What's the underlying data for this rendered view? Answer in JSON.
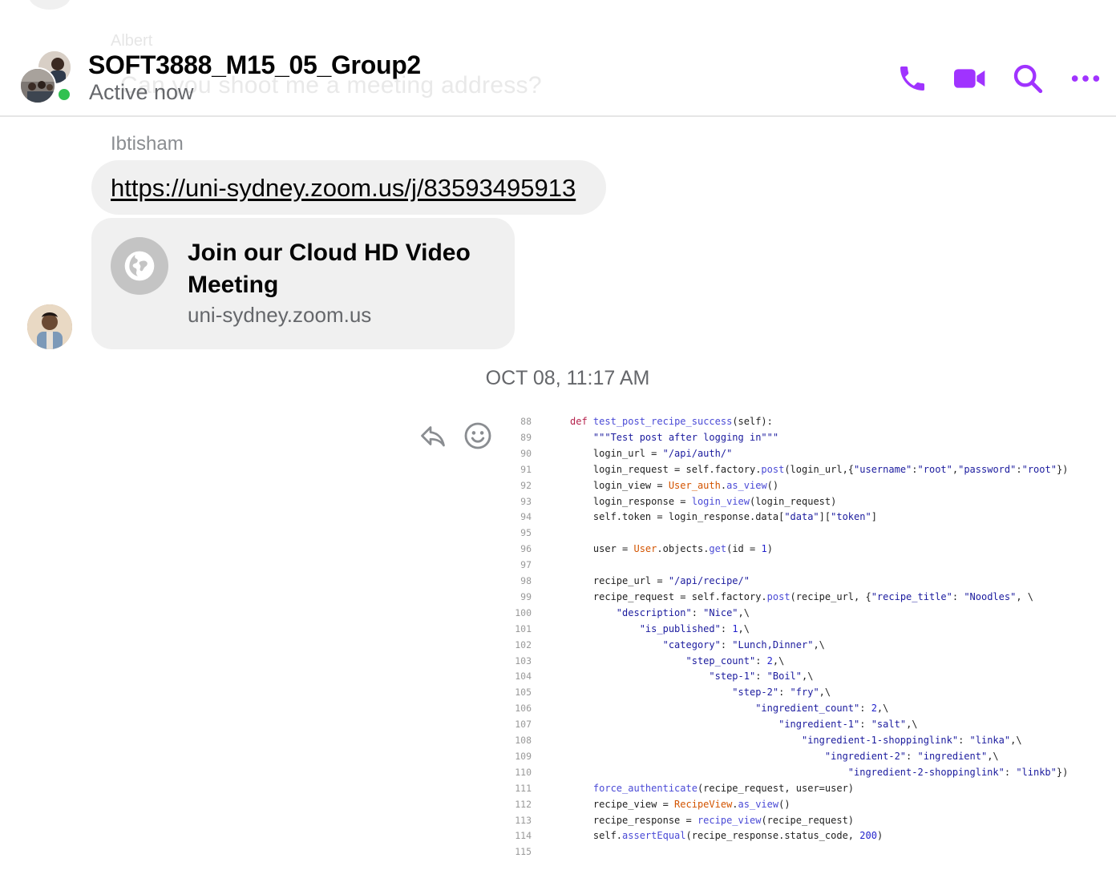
{
  "header": {
    "title": "SOFT3888_M15_05_Group2",
    "status": "Active now",
    "accent_color": "#a033ff",
    "actions": [
      "phone-icon",
      "video-camera-icon",
      "search-icon",
      "more-icon"
    ]
  },
  "ghost": {
    "name": "Albert",
    "message": "Can you shoot me a meeting address?"
  },
  "message": {
    "sender": "Ibtisham",
    "link_text": "https://uni-sydney.zoom.us/j/83593495913",
    "preview_title": "Join our Cloud HD Video Meeting",
    "preview_domain": "uni-sydney.zoom.us"
  },
  "timestamp": "OCT 08, 11:17 AM",
  "message_actions": [
    "reply-icon",
    "emoji-icon"
  ],
  "code_image": {
    "lines": [
      {
        "n": "88",
        "html": "<span class='kw'>def</span> <span class='fn'>test_post_recipe_success</span>(self):"
      },
      {
        "n": "89",
        "html": "    <span class='str'>\"\"\"Test post after logging in\"\"\"</span>"
      },
      {
        "n": "90",
        "html": "    login_url = <span class='str'>\"/api/auth/\"</span>"
      },
      {
        "n": "91",
        "html": "    login_request = self.factory.<span class='fn'>post</span>(login_url,{<span class='str'>\"username\"</span>:<span class='str'>\"root\"</span>,<span class='str'>\"password\"</span>:<span class='str'>\"root\"</span>})"
      },
      {
        "n": "92",
        "html": "    login_view = <span class='cls'>User_auth</span>.<span class='fn'>as_view</span>()"
      },
      {
        "n": "93",
        "html": "    login_response = <span class='fn'>login_view</span>(login_request)"
      },
      {
        "n": "94",
        "html": "    self.token = login_response.data[<span class='str'>\"data\"</span>][<span class='str'>\"token\"</span>]"
      },
      {
        "n": "95",
        "html": ""
      },
      {
        "n": "96",
        "html": "    user = <span class='cls'>User</span>.objects.<span class='fn'>get</span>(id = <span class='num'>1</span>)"
      },
      {
        "n": "97",
        "html": ""
      },
      {
        "n": "98",
        "html": "    recipe_url = <span class='str'>\"/api/recipe/\"</span>"
      },
      {
        "n": "99",
        "html": "    recipe_request = self.factory.<span class='fn'>post</span>(recipe_url, {<span class='str'>\"recipe_title\"</span>: <span class='str'>\"Noodles\"</span>, \\"
      },
      {
        "n": "100",
        "html": "        <span class='str'>\"description\"</span>: <span class='str'>\"Nice\"</span>,\\"
      },
      {
        "n": "101",
        "html": "            <span class='str'>\"is_published\"</span>: <span class='num'>1</span>,\\"
      },
      {
        "n": "102",
        "html": "                <span class='str'>\"category\"</span>: <span class='str'>\"Lunch,Dinner\"</span>,\\"
      },
      {
        "n": "103",
        "html": "                    <span class='str'>\"step_count\"</span>: <span class='num'>2</span>,\\"
      },
      {
        "n": "104",
        "html": "                        <span class='str'>\"step-1\"</span>: <span class='str'>\"Boil\"</span>,\\"
      },
      {
        "n": "105",
        "html": "                            <span class='str'>\"step-2\"</span>: <span class='str'>\"fry\"</span>,\\"
      },
      {
        "n": "106",
        "html": "                                <span class='str'>\"ingredient_count\"</span>: <span class='num'>2</span>,\\"
      },
      {
        "n": "107",
        "html": "                                    <span class='str'>\"ingredient-1\"</span>: <span class='str'>\"salt\"</span>,\\"
      },
      {
        "n": "108",
        "html": "                                        <span class='str'>\"ingredient-1-shoppinglink\"</span>: <span class='str'>\"linka\"</span>,\\"
      },
      {
        "n": "109",
        "html": "                                            <span class='str'>\"ingredient-2\"</span>: <span class='str'>\"ingredient\"</span>,\\"
      },
      {
        "n": "110",
        "html": "                                                <span class='str'>\"ingredient-2-shoppinglink\"</span>: <span class='str'>\"linkb\"</span>})"
      },
      {
        "n": "111",
        "html": "    <span class='fn'>force_authenticate</span>(recipe_request, user=user)"
      },
      {
        "n": "112",
        "html": "    recipe_view = <span class='cls'>RecipeView</span>.<span class='fn'>as_view</span>()"
      },
      {
        "n": "113",
        "html": "    recipe_response = <span class='fn'>recipe_view</span>(recipe_request)"
      },
      {
        "n": "114",
        "html": "    self.<span class='fn'>assertEqual</span>(recipe_response.status_code, <span class='num'>200</span>)"
      },
      {
        "n": "115",
        "html": ""
      }
    ]
  }
}
